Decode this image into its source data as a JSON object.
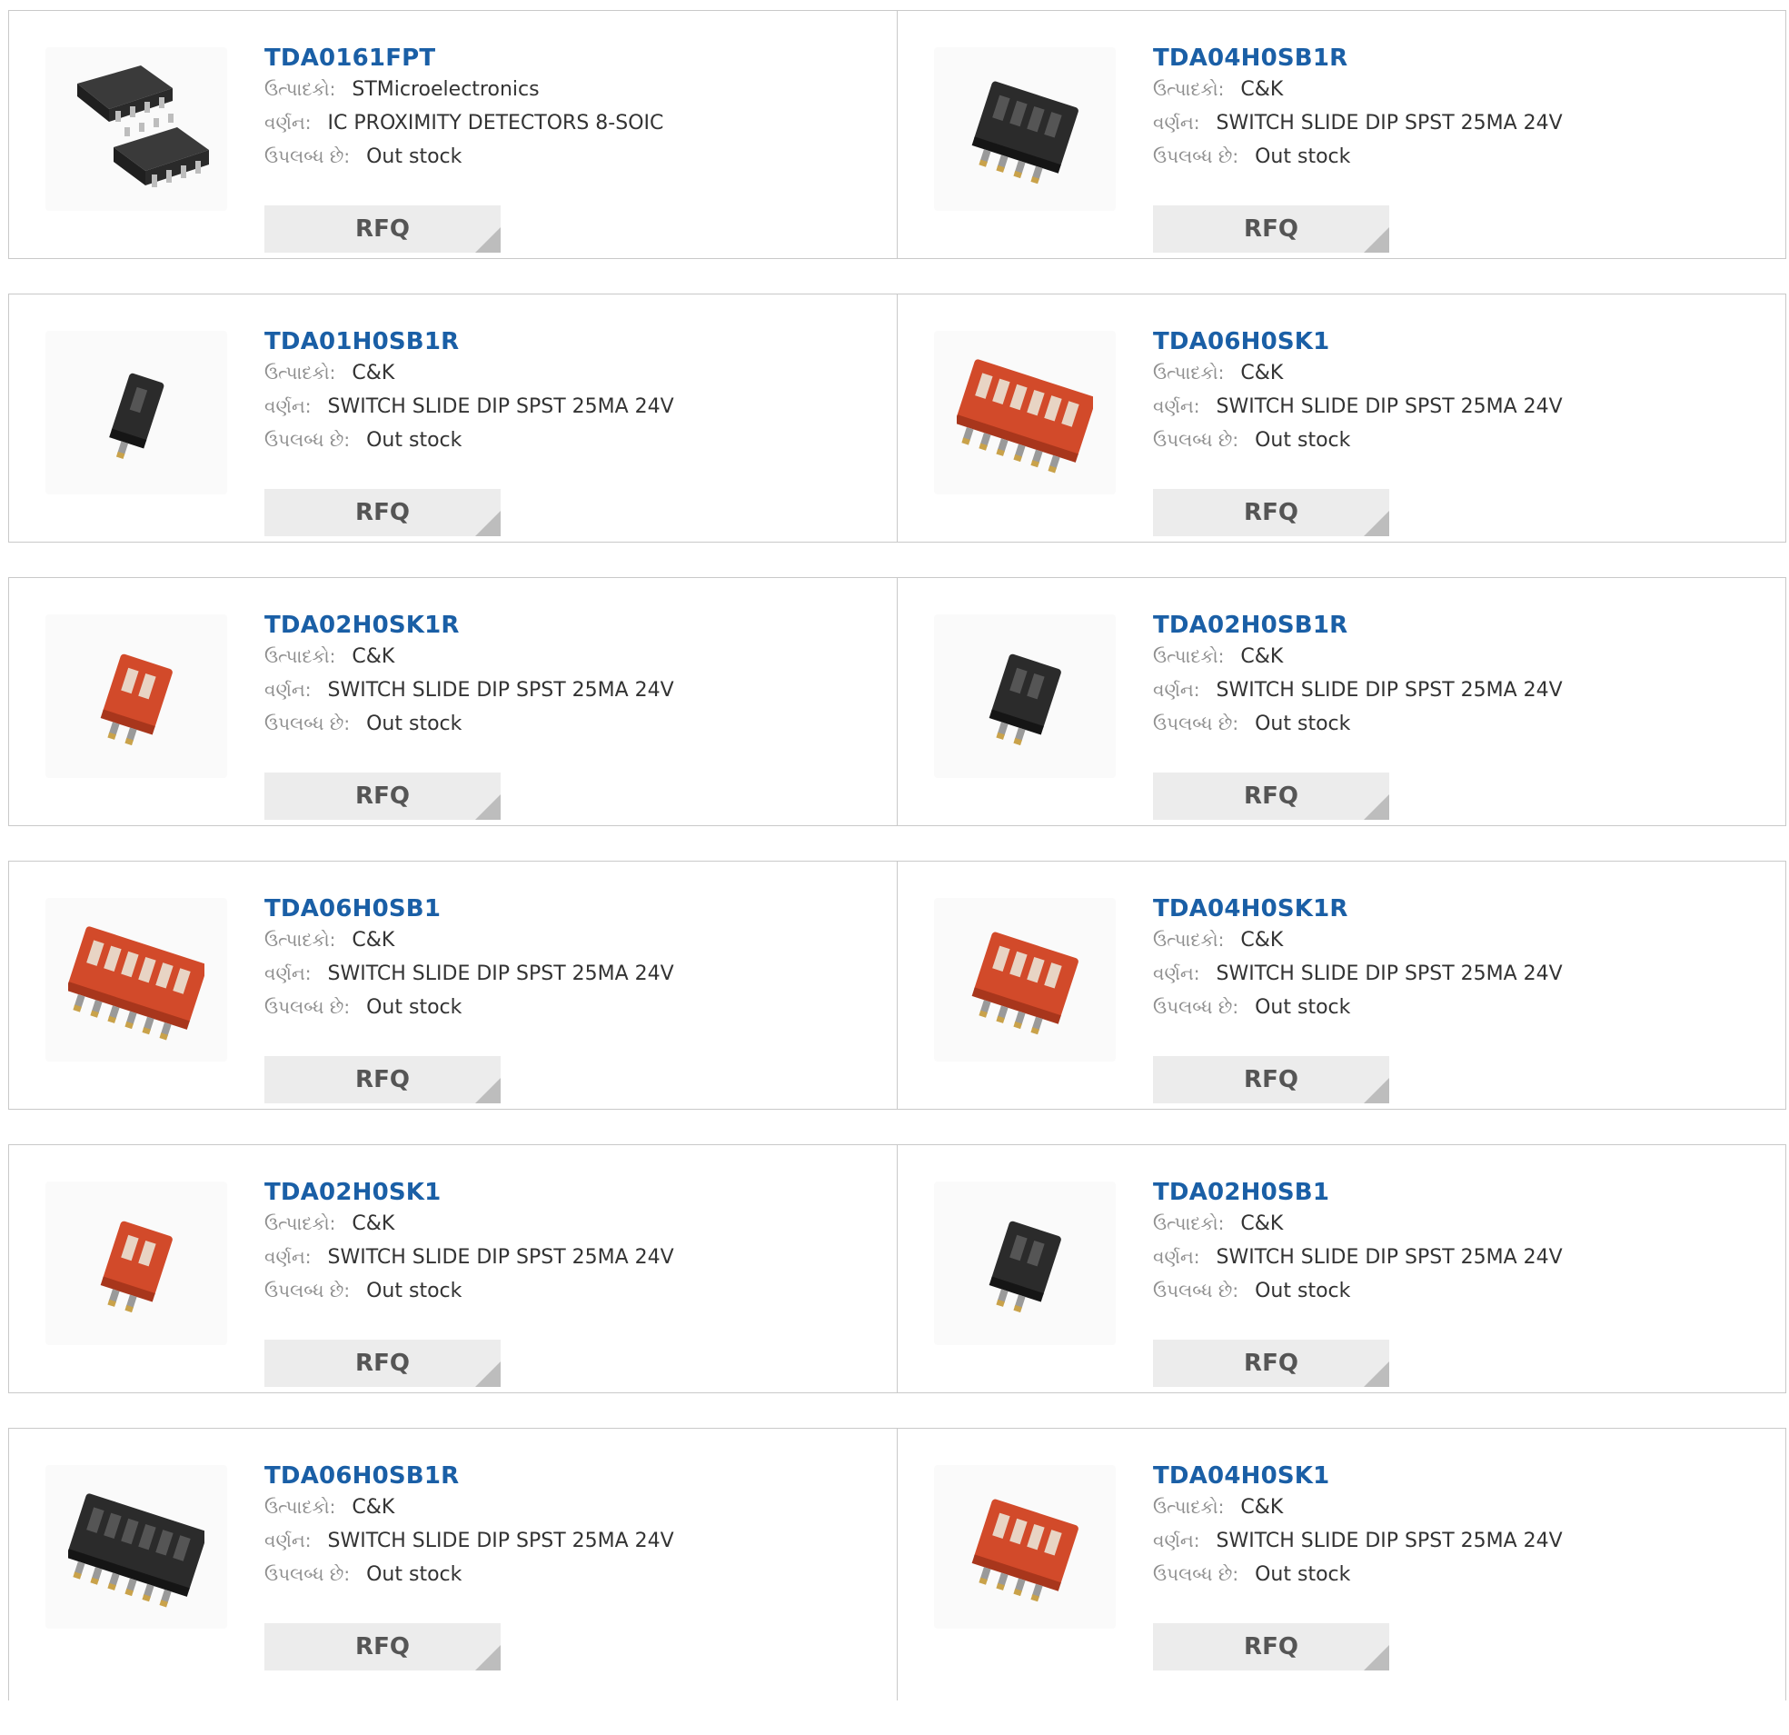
{
  "labels": {
    "manufacturer": "ઉત્પાદકો:",
    "description": "વર્ણન:",
    "availability": "ઉપલબ્ધ છે:",
    "rfq": "RFQ"
  },
  "products": [
    {
      "part": "TDA0161FPT",
      "manufacturer": "STMicroelectronics",
      "description": "IC PROXIMITY DETECTORS 8-SOIC",
      "availability": "Out stock",
      "image": "soic-chip"
    },
    {
      "part": "TDA04H0SB1R",
      "manufacturer": "C&K",
      "description": "SWITCH SLIDE DIP SPST 25MA 24V",
      "availability": "Out stock",
      "image": "dip-black-4"
    },
    {
      "part": "TDA01H0SB1R",
      "manufacturer": "C&K",
      "description": "SWITCH SLIDE DIP SPST 25MA 24V",
      "availability": "Out stock",
      "image": "dip-black-1"
    },
    {
      "part": "TDA06H0SK1",
      "manufacturer": "C&K",
      "description": "SWITCH SLIDE DIP SPST 25MA 24V",
      "availability": "Out stock",
      "image": "dip-red-6"
    },
    {
      "part": "TDA02H0SK1R",
      "manufacturer": "C&K",
      "description": "SWITCH SLIDE DIP SPST 25MA 24V",
      "availability": "Out stock",
      "image": "dip-red-2"
    },
    {
      "part": "TDA02H0SB1R",
      "manufacturer": "C&K",
      "description": "SWITCH SLIDE DIP SPST 25MA 24V",
      "availability": "Out stock",
      "image": "dip-black-2"
    },
    {
      "part": "TDA06H0SB1",
      "manufacturer": "C&K",
      "description": "SWITCH SLIDE DIP SPST 25MA 24V",
      "availability": "Out stock",
      "image": "dip-red-6"
    },
    {
      "part": "TDA04H0SK1R",
      "manufacturer": "C&K",
      "description": "SWITCH SLIDE DIP SPST 25MA 24V",
      "availability": "Out stock",
      "image": "dip-red-4"
    },
    {
      "part": "TDA02H0SK1",
      "manufacturer": "C&K",
      "description": "SWITCH SLIDE DIP SPST 25MA 24V",
      "availability": "Out stock",
      "image": "dip-red-2"
    },
    {
      "part": "TDA02H0SB1",
      "manufacturer": "C&K",
      "description": "SWITCH SLIDE DIP SPST 25MA 24V",
      "availability": "Out stock",
      "image": "dip-black-2"
    },
    {
      "part": "TDA06H0SB1R",
      "manufacturer": "C&K",
      "description": "SWITCH SLIDE DIP SPST 25MA 24V",
      "availability": "Out stock",
      "image": "dip-black-6"
    },
    {
      "part": "TDA04H0SK1",
      "manufacturer": "C&K",
      "description": "SWITCH SLIDE DIP SPST 25MA 24V",
      "availability": "Out stock",
      "image": "dip-red-4"
    }
  ],
  "colors": {
    "link": "#1a5fa6",
    "label": "#8f8f8f",
    "rfq_bg": "#ececec",
    "border": "#c9c9c9",
    "dip_red": "#d24a2a",
    "dip_black": "#2a2a2a"
  }
}
